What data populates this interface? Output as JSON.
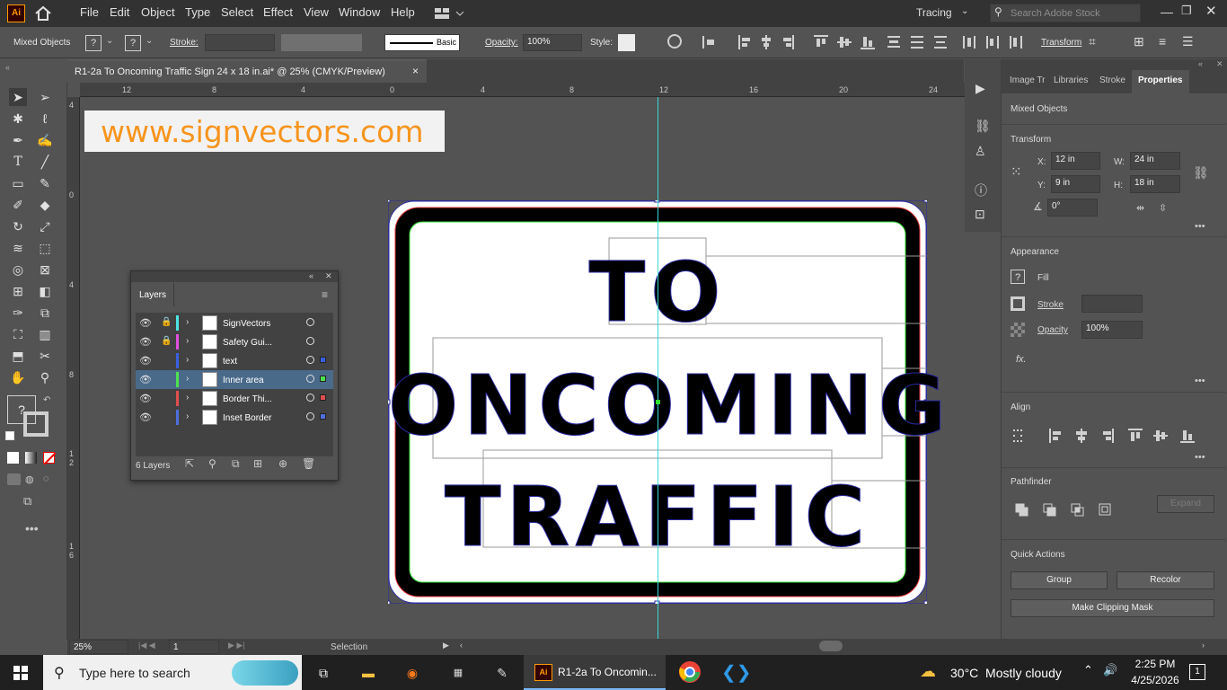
{
  "app": {
    "logo": "Ai",
    "workspace": "Tracing",
    "search_placeholder": "Search Adobe Stock"
  },
  "menu": [
    "File",
    "Edit",
    "Object",
    "Type",
    "Select",
    "Effect",
    "View",
    "Window",
    "Help"
  ],
  "control": {
    "selection": "Mixed Objects",
    "stroke_label": "Stroke:",
    "brush": "Basic",
    "opacity_label": "Opacity:",
    "opacity": "100%",
    "style_label": "Style:",
    "transform": "Transform"
  },
  "document": {
    "tab_title": "R1-2a To Oncoming Traffic Sign 24 x 18 in.ai* @ 25% (CMYK/Preview)",
    "close": "×"
  },
  "ruler": {
    "h_ticks": [
      "12",
      "8",
      "4",
      "0",
      "4",
      "8",
      "12",
      "16",
      "20",
      "24"
    ],
    "v_ticks": [
      "4",
      "0",
      "4",
      "8",
      "1\n2",
      "1\n6"
    ]
  },
  "watermark": "www.signvectors.com",
  "sign": {
    "line1": "TO",
    "line2": "ONCOMING",
    "line3": "TRAFFIC"
  },
  "layers": {
    "title": "Layers",
    "items": [
      {
        "name": "SignVectors",
        "color": "#4fe3e3",
        "locked": true,
        "selected": false,
        "swatch": ""
      },
      {
        "name": "Safety Gui...",
        "color": "#e04fe0",
        "locked": true,
        "selected": false,
        "swatch": ""
      },
      {
        "name": "text",
        "color": "#3a5fe0",
        "locked": false,
        "selected": false,
        "swatch": "#3a5fe0"
      },
      {
        "name": "Inner area",
        "color": "#4fe04f",
        "locked": false,
        "selected": true,
        "swatch": "#4fe04f"
      },
      {
        "name": "Border Thi...",
        "color": "#e04f4f",
        "locked": false,
        "selected": false,
        "swatch": "#e04f4f"
      },
      {
        "name": "Inset Border",
        "color": "#4f6fe0",
        "locked": false,
        "selected": false,
        "swatch": "#4f6fe0"
      }
    ],
    "count": "6 Layers"
  },
  "panel": {
    "tabs": [
      "Image Tr",
      "Libraries",
      "Stroke",
      "Properties"
    ],
    "active_tab": "Properties",
    "selection": "Mixed Objects",
    "transform": {
      "title": "Transform",
      "x_label": "X:",
      "x": "12 in",
      "w_label": "W:",
      "w": "24 in",
      "y_label": "Y:",
      "y": "9 in",
      "h_label": "H:",
      "h": "18 in",
      "angle": "0°"
    },
    "appearance": {
      "title": "Appearance",
      "fill": "Fill",
      "stroke": "Stroke",
      "opacity_label": "Opacity",
      "opacity": "100%",
      "fx": "fx."
    },
    "align": {
      "title": "Align"
    },
    "pathfinder": {
      "title": "Pathfinder",
      "expand": "Expand"
    },
    "quick_actions": {
      "title": "Quick Actions",
      "group": "Group",
      "recolor": "Recolor",
      "clipping": "Make Clipping Mask"
    }
  },
  "status": {
    "zoom": "25%",
    "artboard": "1",
    "tool": "Selection"
  },
  "taskbar": {
    "search": "Type here to search",
    "active_app": "R1-2a To Oncomin...",
    "weather": "30°C  Mostly cloudy",
    "time": "2:25 PM",
    "date": "4/25/2026",
    "notifications": "1"
  }
}
